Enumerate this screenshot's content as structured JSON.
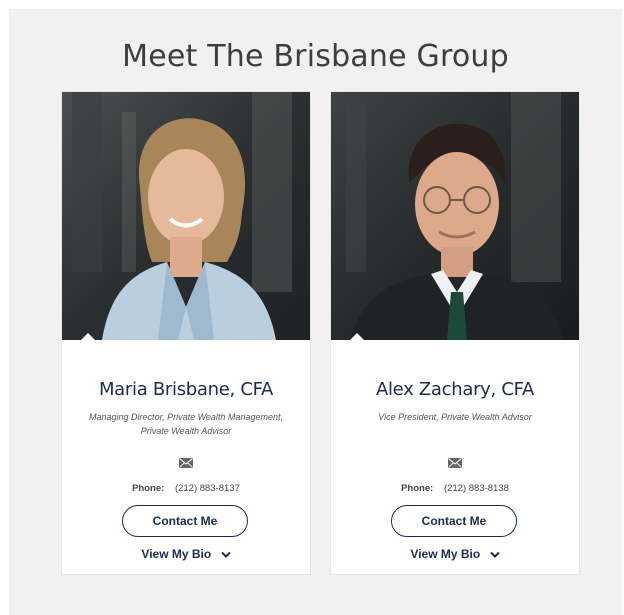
{
  "section": {
    "heading": "Meet The Brisbane Group"
  },
  "team": [
    {
      "name": "Maria Brisbane, CFA",
      "title": "Managing Director, Private Wealth Management, Private Wealth Advisor",
      "phone_label": "Phone:",
      "phone": "(212) 883-8137",
      "contact_label": "Contact Me",
      "bio_label": "View My Bio"
    },
    {
      "name": "Alex Zachary, CFA",
      "title": "Vice President, Private Wealth Advisor",
      "phone_label": "Phone:",
      "phone": "(212) 883-8138",
      "contact_label": "Contact Me",
      "bio_label": "View My Bio"
    }
  ],
  "icons": {
    "mail": "envelope-icon",
    "expand": "chevron-down-icon"
  },
  "colors": {
    "brand": "#1c2b52",
    "panel_bg": "#f1f1f1"
  }
}
